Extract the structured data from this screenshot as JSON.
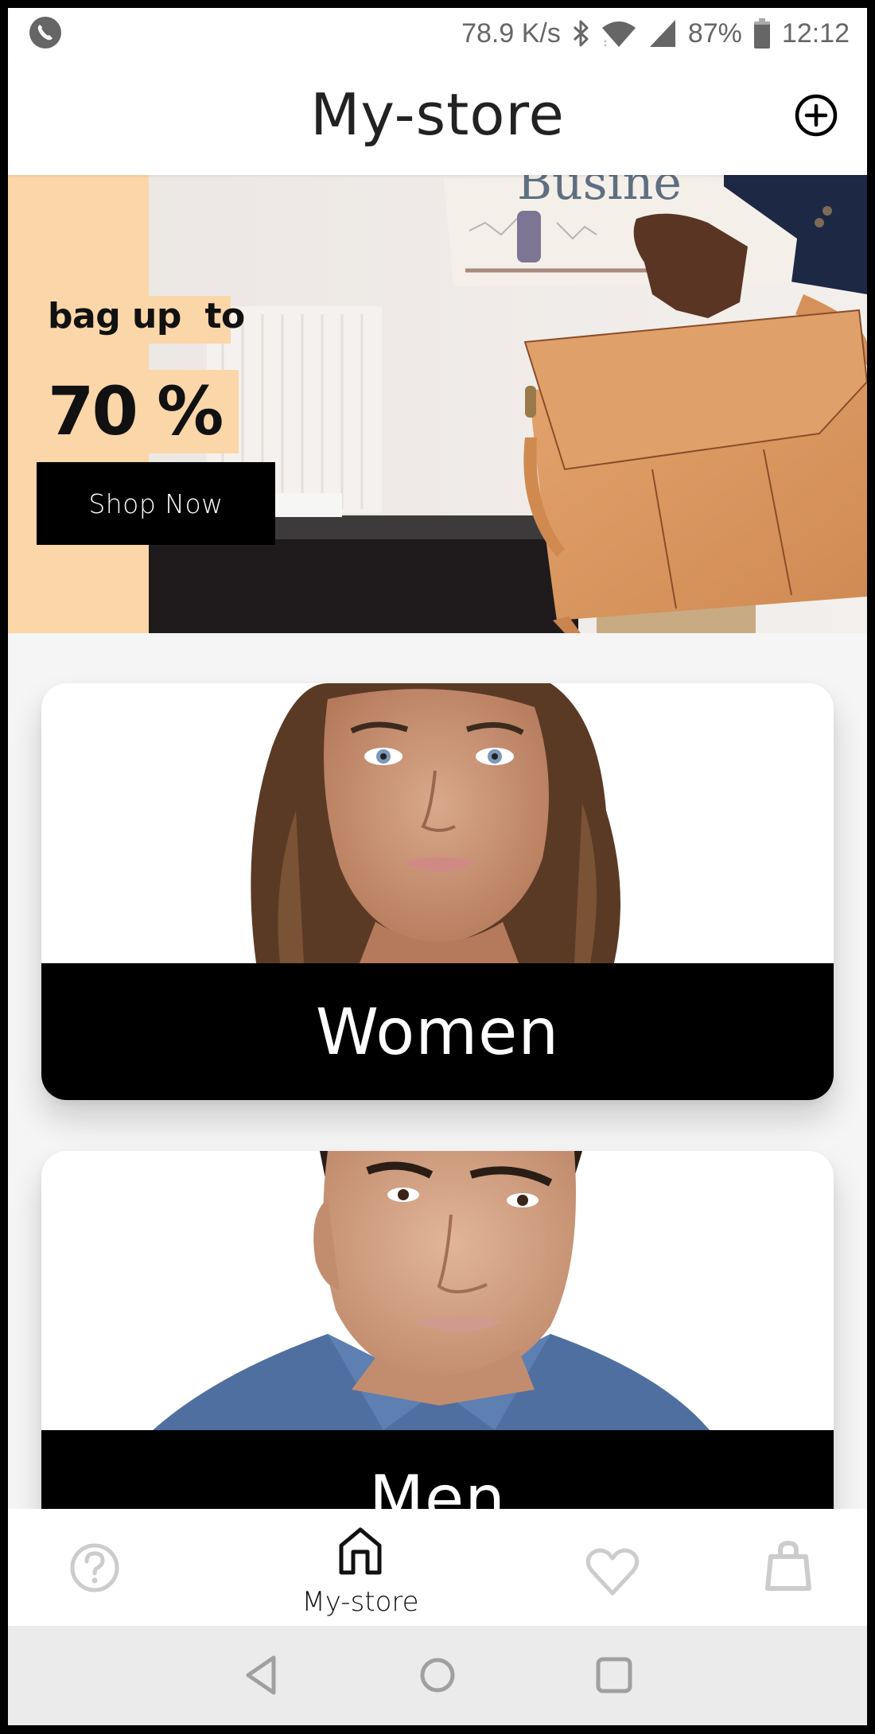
{
  "status_bar": {
    "left_icon": "phone-call-icon",
    "network_speed": "78.9 K/s",
    "icons": [
      "bluetooth-icon",
      "wifi-icon",
      "cell-signal-icon"
    ],
    "battery": "87%",
    "battery_icon": "battery-icon",
    "time": "12:12"
  },
  "header": {
    "title": "My-store",
    "action_icon": "add-circle-icon"
  },
  "banner": {
    "headline": "bag up  to",
    "discount": "70 %",
    "cta_label": "Shop Now",
    "accent_color": "#FBD6A8"
  },
  "categories": [
    {
      "label": "Women",
      "image": "woman-portrait"
    },
    {
      "label": "Men",
      "image": "man-portrait"
    }
  ],
  "bottom_tabs": [
    {
      "id": "help",
      "icon": "help-circle-icon",
      "label": "",
      "active": false
    },
    {
      "id": "home",
      "icon": "home-icon",
      "label": "My-store",
      "active": true
    },
    {
      "id": "favorites",
      "icon": "heart-icon",
      "label": "",
      "active": false
    },
    {
      "id": "bag",
      "icon": "shopping-bag-icon",
      "label": "",
      "active": false
    }
  ],
  "system_nav": {
    "buttons": [
      "back-icon",
      "home-circle-icon",
      "recents-icon"
    ]
  },
  "colors": {
    "active_tab": "#111111",
    "inactive_tab": "#CCCCCC",
    "label_band": "#000000",
    "page_background": "#F5F5F5"
  }
}
